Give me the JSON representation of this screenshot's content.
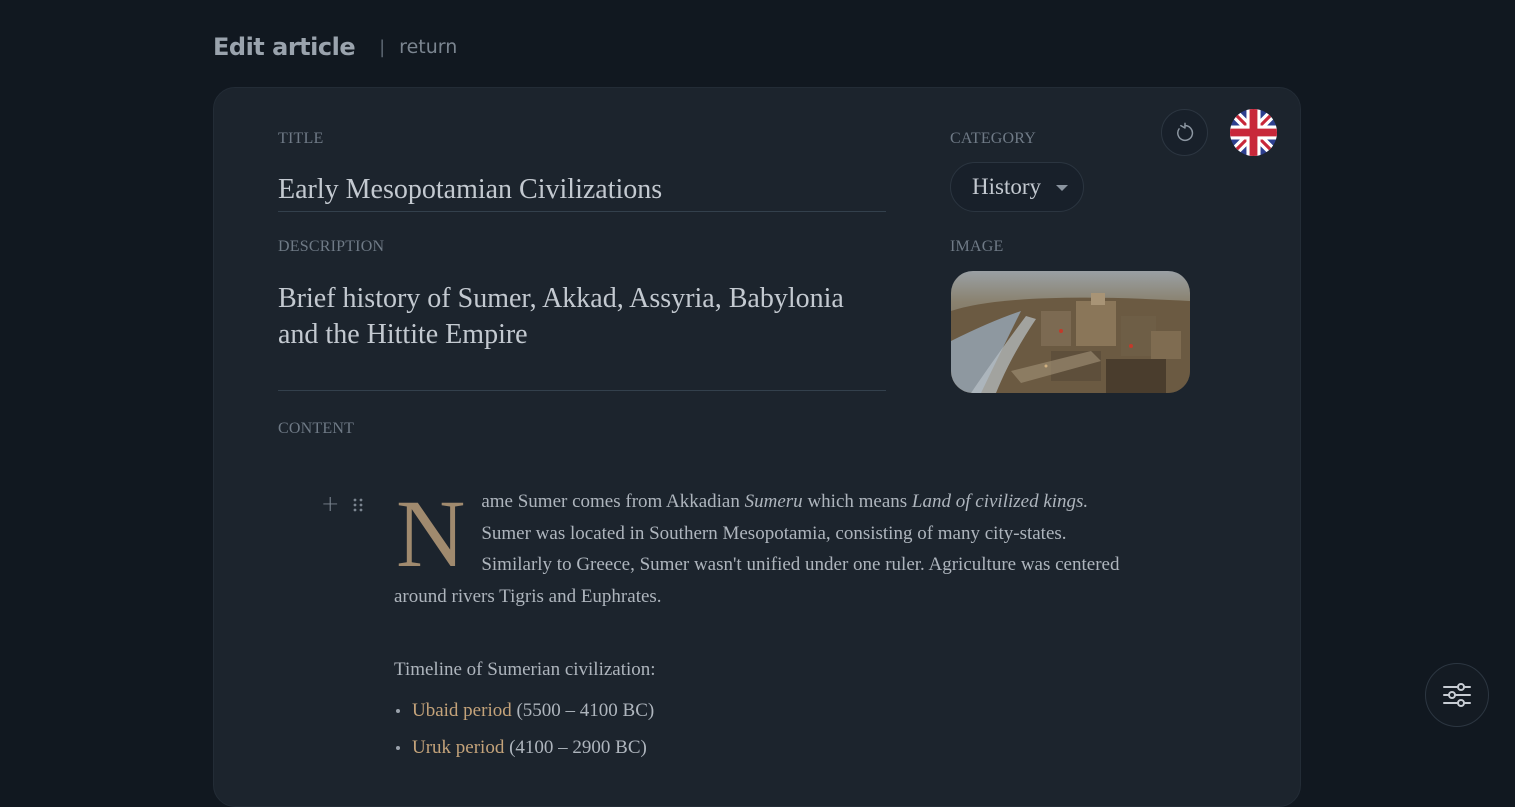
{
  "header": {
    "title": "Edit article",
    "separator": "|",
    "return_label": "return"
  },
  "form": {
    "title_label": "TITLE",
    "title_value": "Early Mesopotamian Civilizations",
    "description_label": "DESCRIPTION",
    "description_value": "Brief history of Sumer, Akkad, Assyria, Babylonia and the Hittite Empire",
    "category_label": "CATEGORY",
    "category_value": "History",
    "image_label": "IMAGE",
    "content_label": "CONTENT"
  },
  "icons": {
    "reset": "refresh-icon",
    "language": "uk-flag-icon",
    "add_block": "plus-icon",
    "drag_block": "drag-handle-icon",
    "settings": "sliders-icon"
  },
  "content": {
    "dropcap": "N",
    "para1_part1": "ame Sumer comes from Akkadian ",
    "para1_em1": "Sumeru",
    "para1_part2": " which means ",
    "para1_em2": "Land of civilized kings.",
    "para1_part3": " Sumer was located in Southern Mesopotamia, consisting of many city-states. Similarly to Greece, Sumer wasn't unified under one ruler. Agriculture was centered around rivers Tigris and Euphrates.",
    "timeline_heading": "Timeline of Sumerian civilization:",
    "timeline": [
      {
        "name": "Ubaid period",
        "range": "(5500 – 4100 BC)"
      },
      {
        "name": "Uruk period",
        "range": "(4100 – 2900 BC)"
      }
    ]
  },
  "colors": {
    "background": "#111820",
    "card": "#1c242d",
    "accent": "#c4a37a",
    "dropcap": "#a08a6e"
  }
}
